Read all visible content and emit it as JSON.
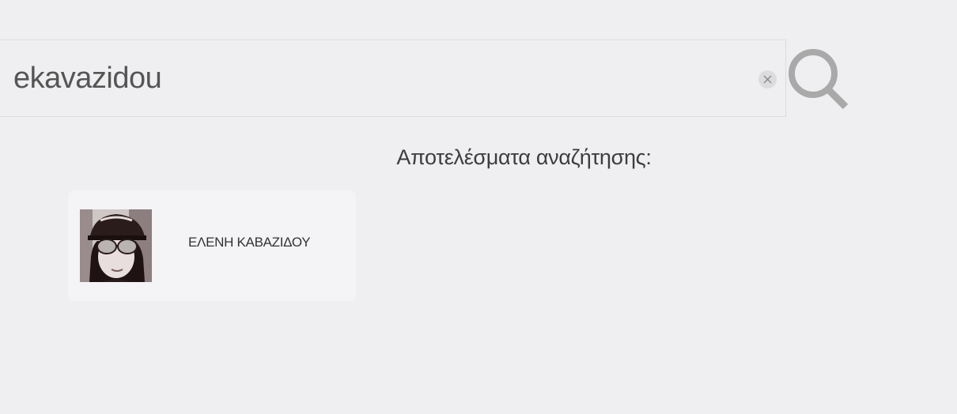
{
  "search": {
    "value": "ekavazidou",
    "clear_icon": "close-icon",
    "submit_icon": "search-icon"
  },
  "results": {
    "heading": "Αποτελέσματα αναζήτησης:",
    "items": [
      {
        "name": "ΕΛΕΝΗ ΚΑΒΑΖΙΔΟΥ",
        "avatar_icon": "user-avatar"
      }
    ]
  },
  "colors": {
    "background": "#efeff1",
    "card_background": "#f4f3f6",
    "icon_gray": "#a9a9a9",
    "text_dark": "#3d3d3d"
  }
}
